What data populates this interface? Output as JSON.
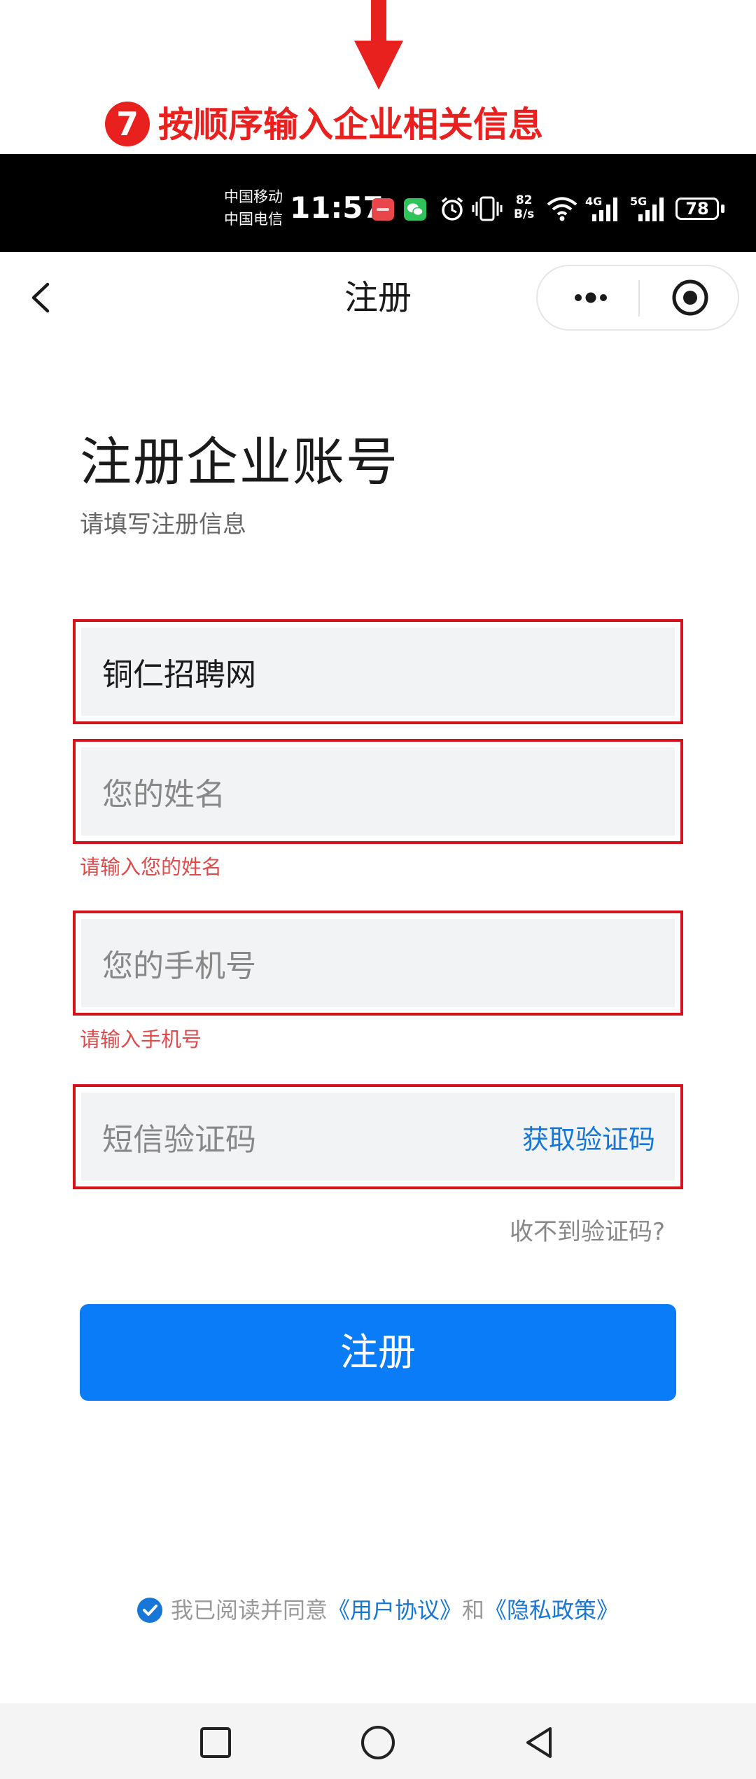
{
  "annotation": {
    "step_number": "7",
    "text": "按顺序输入企业相关信息",
    "color": "#e8211f"
  },
  "status_bar": {
    "carrier_1": "中国移动",
    "carrier_2": "中国电信",
    "time": "11:57",
    "net_speed_value": "82",
    "net_speed_unit": "B/s",
    "signal_1_label": "4G",
    "signal_2_label": "5G",
    "battery": "78",
    "icons": [
      "huawei-app-icon",
      "wechat-icon",
      "alarm-icon",
      "vibrate-icon",
      "wifi-icon",
      "signal-icon",
      "signal-icon",
      "battery-icon"
    ]
  },
  "nav": {
    "title": "注册",
    "back_icon": "chevron-left-icon",
    "more_icon": "more-dots-icon",
    "close_icon": "target-close-icon"
  },
  "page": {
    "heading": "注册企业账号",
    "subtitle": "请填写注册信息"
  },
  "form": {
    "company": {
      "value": "铜仁招聘网"
    },
    "name": {
      "placeholder": "您的姓名",
      "error": "请输入您的姓名"
    },
    "phone": {
      "placeholder": "您的手机号",
      "error": "请输入手机号"
    },
    "sms_code": {
      "placeholder": "短信验证码",
      "get_code_label": "获取验证码"
    },
    "resend_help": "收不到验证码?",
    "submit_label": "注册",
    "highlight_color": "#d4141b",
    "accent_color": "#0a7cf8"
  },
  "agreement": {
    "prefix": "我已阅读并同意",
    "user_agreement": "《用户协议》",
    "conjunction": "和",
    "privacy_policy": "《隐私政策》",
    "checked": true
  },
  "system_nav": {
    "icons": [
      "recent-apps-icon",
      "home-icon",
      "back-icon"
    ]
  }
}
